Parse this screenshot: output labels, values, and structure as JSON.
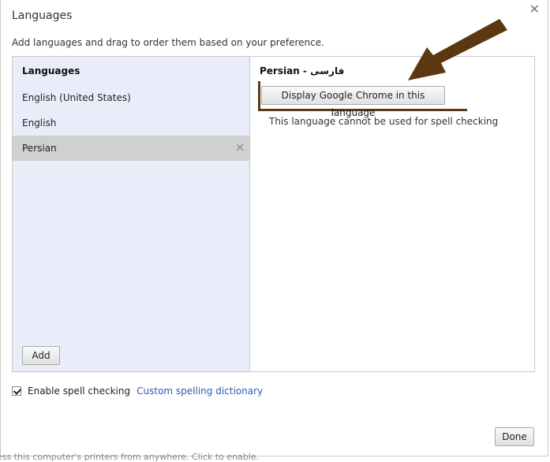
{
  "dialog": {
    "title": "Languages",
    "hint": "Add languages and drag to order them based on your preference."
  },
  "left_panel": {
    "header": "Languages",
    "items": [
      {
        "label": "English (United States)"
      },
      {
        "label": "English"
      },
      {
        "label": "Persian",
        "selected": true
      }
    ],
    "add_label": "Add"
  },
  "right_panel": {
    "title": "Persian - فارسی",
    "display_button_label": "Display Google Chrome in this language",
    "spell_note": "This language cannot be used for spell checking"
  },
  "footer": {
    "enable_spell_label": "Enable spell checking",
    "enable_spell_checked": true,
    "dictionary_link": "Custom spelling dictionary",
    "done_label": "Done"
  },
  "background": {
    "partial_text": "ess this computer's printers from anywhere. Click to enable."
  },
  "icons": {
    "close": "close-icon",
    "remove": "remove-icon",
    "arrow": "arrow-annotation-icon"
  },
  "colors": {
    "left_panel_bg": "#e8edf9",
    "selected_bg": "#d0d0d0",
    "link": "#2a5db0",
    "annotation": "#5c3812"
  }
}
